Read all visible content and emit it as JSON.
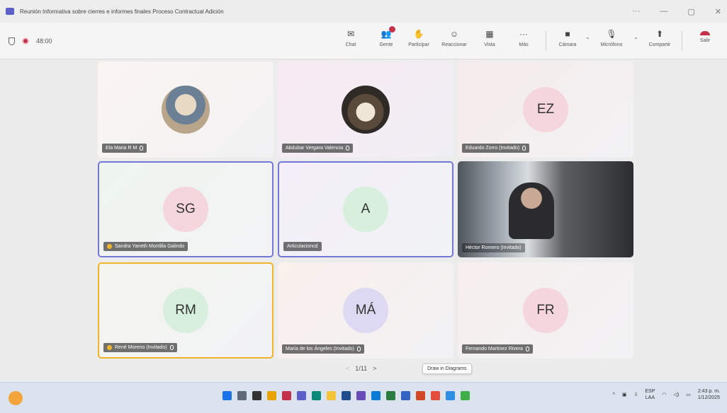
{
  "window": {
    "title": "Reunión Informativa sobre cierres e informes finales Proceso Contractual Adición",
    "controls": [
      "···",
      "—",
      "▢",
      "✕"
    ]
  },
  "toolbar": {
    "timer": "48:00",
    "buttons": [
      {
        "label": "Chat",
        "icon": "chat-icon",
        "glyph": "✉"
      },
      {
        "label": "Gente",
        "icon": "people-icon",
        "glyph": "👥"
      },
      {
        "label": "Participar",
        "icon": "raise-hand-icon",
        "glyph": "✋"
      },
      {
        "label": "Reaccionar",
        "icon": "react-icon",
        "glyph": "☺"
      },
      {
        "label": "Vista",
        "icon": "view-icon",
        "glyph": "▦"
      },
      {
        "label": "Más",
        "icon": "more-icon",
        "glyph": "···"
      },
      {
        "label": "Cámara",
        "icon": "camera-icon",
        "glyph": "■"
      },
      {
        "label": "Micrófono",
        "icon": "microphone-icon",
        "glyph": "🎙"
      },
      {
        "label": "Compartir",
        "icon": "share-icon",
        "glyph": "⬆"
      },
      {
        "label": "Salir",
        "icon": "leave-icon",
        "glyph": ""
      }
    ]
  },
  "participants": [
    {
      "name": "Ela Maria R M",
      "initials": "",
      "avatar_color": "#c7b8a0",
      "photo": true
    },
    {
      "name": "Abdubar Vergara Valencia",
      "initials": "",
      "avatar_color": "#a08a70",
      "photo": true
    },
    {
      "name": "Eduardo Zorro (Invitado)",
      "initials": "EZ",
      "avatar_color": "#f4d6dc"
    },
    {
      "name": "Sandra Yaneth Montilla Galindo",
      "initials": "SG",
      "avatar_color": "#f4d6dc"
    },
    {
      "name": "Articulacioncd",
      "initials": "A",
      "avatar_color": "#d7efdc"
    },
    {
      "name": "Héctor Romero (Invitado)",
      "initials": "",
      "video": true
    },
    {
      "name": "René Moreno (Invitado)",
      "initials": "RM",
      "avatar_color": "#d7efdc"
    },
    {
      "name": "María de los Ángeles (Invitado)",
      "initials": "MÁ",
      "avatar_color": "#ddd9f3"
    },
    {
      "name": "Fernando Martinez Rivera",
      "initials": "FR",
      "avatar_color": "#f4d6dc"
    }
  ],
  "pager": {
    "label": "1/11",
    "prev": "<",
    "next": ">"
  },
  "tooltip": "Draw in Diagrams",
  "taskbar": {
    "lang": "ESP",
    "region": "LAA",
    "time": "2:43 p. m.",
    "date": "1/12/2025"
  }
}
